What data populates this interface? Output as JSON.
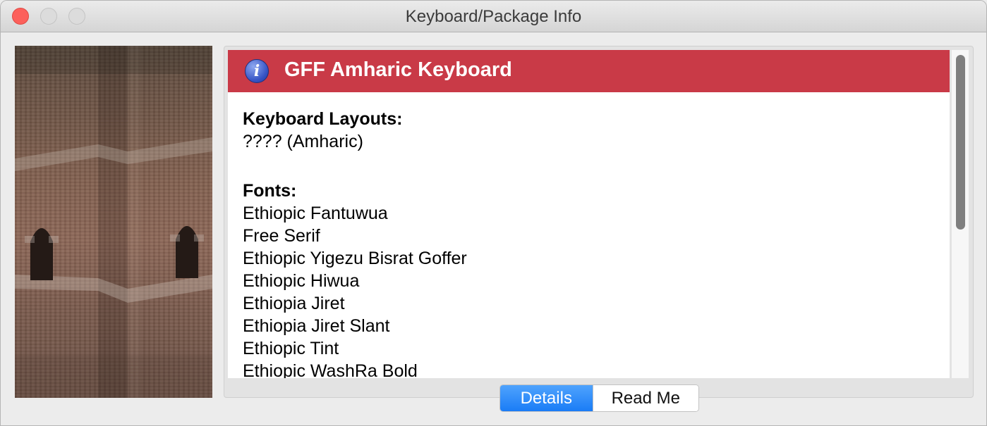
{
  "window": {
    "title": "Keyboard/Package Info"
  },
  "side_image": {
    "alt": "stone church wall photo"
  },
  "header": {
    "icon": "info-icon",
    "icon_glyph": "i",
    "title": "GFF Amharic Keyboard",
    "color": "#c93a47"
  },
  "sections": {
    "layouts_heading": "Keyboard Layouts:",
    "layouts": [
      "???? (Amharic)"
    ],
    "fonts_heading": "Fonts:",
    "fonts": [
      "Ethiopic Fantuwua",
      "Free Serif",
      "Ethiopic Yigezu Bisrat Goffer",
      "Ethiopic Hiwua",
      "Ethiopia Jiret",
      "Ethiopia Jiret Slant",
      "Ethiopic Tint",
      "Ethiopic WashRa Bold"
    ]
  },
  "tabs": {
    "details": "Details",
    "readme": "Read Me",
    "selected": "Details",
    "accent": "#1a7cf6"
  }
}
